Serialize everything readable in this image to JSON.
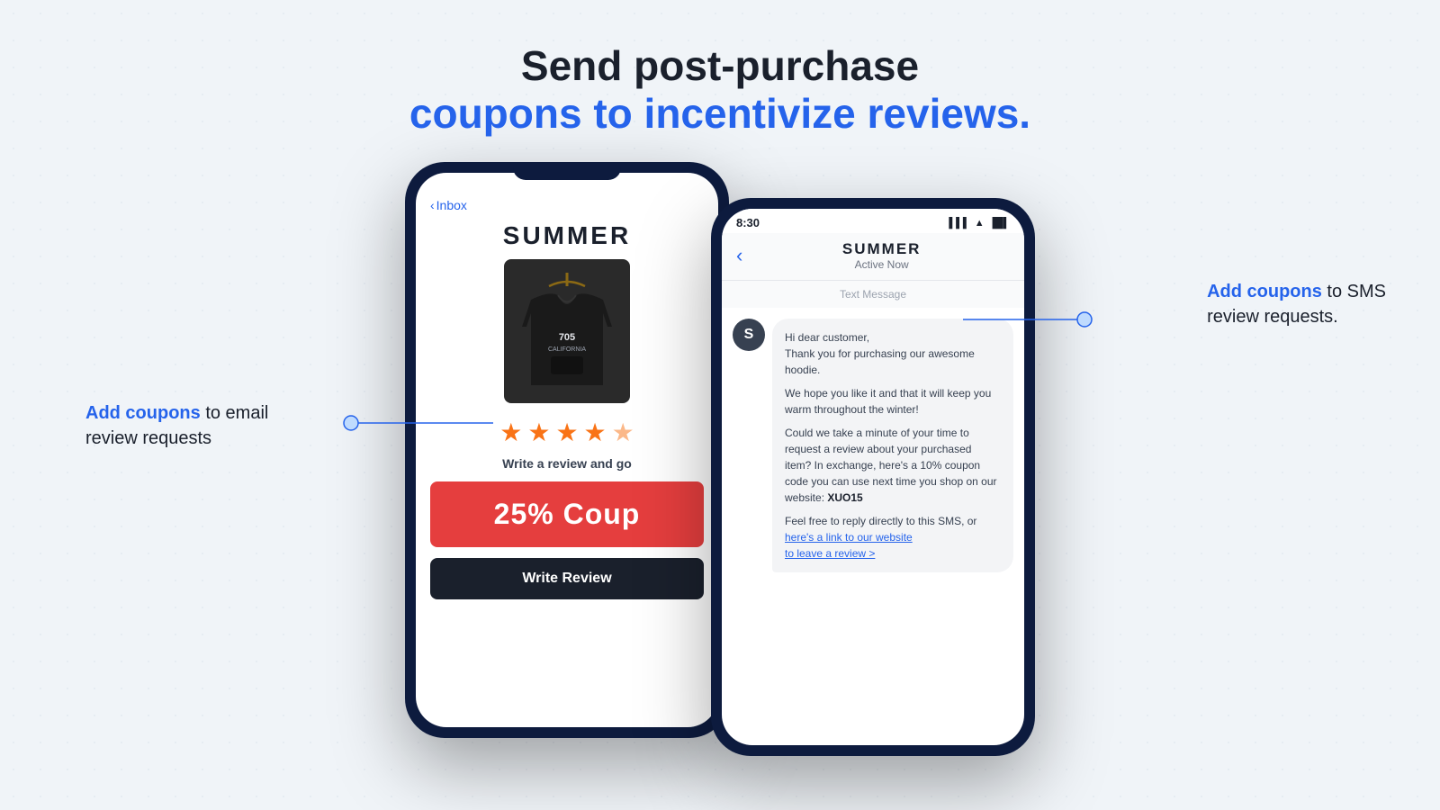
{
  "header": {
    "line1": "Send post-purchase",
    "line2": "coupons to incentivize reviews."
  },
  "phone_email": {
    "inbox_label": "Inbox",
    "brand": "SUMMER",
    "product_label": "705 CALIFORNIA hoodie",
    "review_subtitle": "Write a review and go",
    "coupon_text": "25%  Coup",
    "write_review_btn": "Write Review",
    "stars": [
      "★",
      "★",
      "★",
      "★",
      "☆"
    ]
  },
  "phone_sms": {
    "time": "8:30",
    "contact_name": "SUMMER",
    "contact_status": "Active Now",
    "message_label": "Text Message",
    "avatar_letter": "S",
    "message_parts": [
      "Hi dear customer,\nThank you for purchasing our awesome hoodie.",
      "We hope you like it and that it will keep you warm throughout the winter!",
      "Could we take a minute of your time to request a review about your purchased item? In exchange, here's a 10% coupon code you can use next time you shop on our website: XUO15",
      "Feel free to reply directly to this SMS, or here's a link to our website to leave a review >"
    ],
    "coupon_code": "XUO15",
    "link_text": "here's a link to our website",
    "leave_review": "tO leave review >"
  },
  "annotations": {
    "left": {
      "blue_text": "Add coupons",
      "rest_text": " to email\nreview requests"
    },
    "right": {
      "blue_text": "Add coupons",
      "rest_text": " to SMS\nreview requests."
    }
  }
}
